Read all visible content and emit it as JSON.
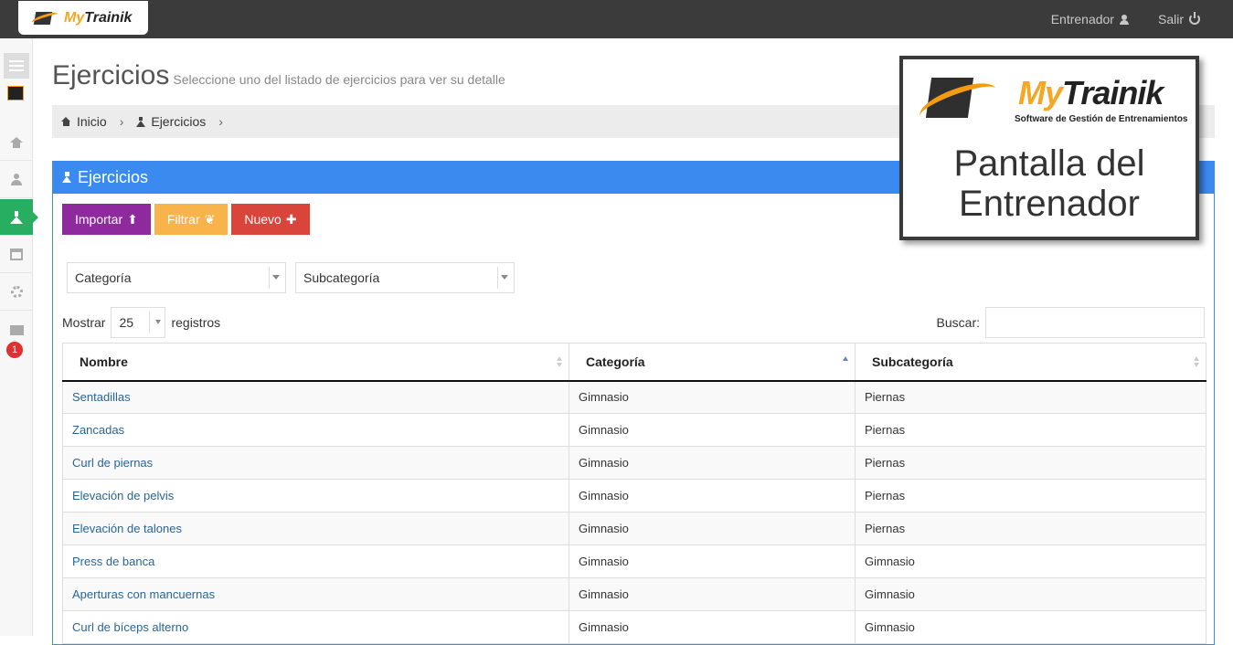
{
  "header": {
    "brand_orange": "My",
    "brand_dark": "Trainik",
    "user_label": "Entrenador",
    "logout_label": "Salir"
  },
  "sidebar": {
    "notification_count": "1",
    "items": [
      "home-icon",
      "user-icon",
      "flask-icon",
      "calendar-icon",
      "gear-icon",
      "envelope-icon"
    ],
    "active_color": "#27ae60"
  },
  "page": {
    "title": "Ejercicios",
    "subtitle": "Seleccione uno del listado de ejercicios para ver su detalle"
  },
  "breadcrumb": {
    "home": "Inicio",
    "current": "Ejercicios"
  },
  "panel": {
    "title": "Ejercicios",
    "accent": "#3b8af0",
    "buttons": {
      "import": "Importar",
      "filter": "Filtrar",
      "new": "Nuevo"
    },
    "filters": {
      "category": "Categoría",
      "subcategory": "Subcategoría"
    },
    "length": {
      "prefix": "Mostrar",
      "value": "25",
      "suffix": "registros"
    },
    "search_label": "Buscar:",
    "search_value": ""
  },
  "table": {
    "columns": [
      "Nombre",
      "Categoría",
      "Subcategoría"
    ],
    "rows": [
      [
        "Sentadillas",
        "Gimnasio",
        "Piernas"
      ],
      [
        "Zancadas",
        "Gimnasio",
        "Piernas"
      ],
      [
        "Curl de piernas",
        "Gimnasio",
        "Piernas"
      ],
      [
        "Elevación de pelvis",
        "Gimnasio",
        "Piernas"
      ],
      [
        "Elevación de talones",
        "Gimnasio",
        "Piernas"
      ],
      [
        "Press de banca",
        "Gimnasio",
        "Gimnasio"
      ],
      [
        "Aperturas con mancuernas",
        "Gimnasio",
        "Gimnasio"
      ],
      [
        "Curl de bíceps alterno",
        "Gimnasio",
        "Gimnasio"
      ]
    ]
  },
  "overlay": {
    "brand_orange": "My",
    "brand_dark": "Trainik",
    "tagline": "Software de Gestión de Entrenamientos",
    "title_line1": "Pantalla del",
    "title_line2": "Entrenador"
  }
}
